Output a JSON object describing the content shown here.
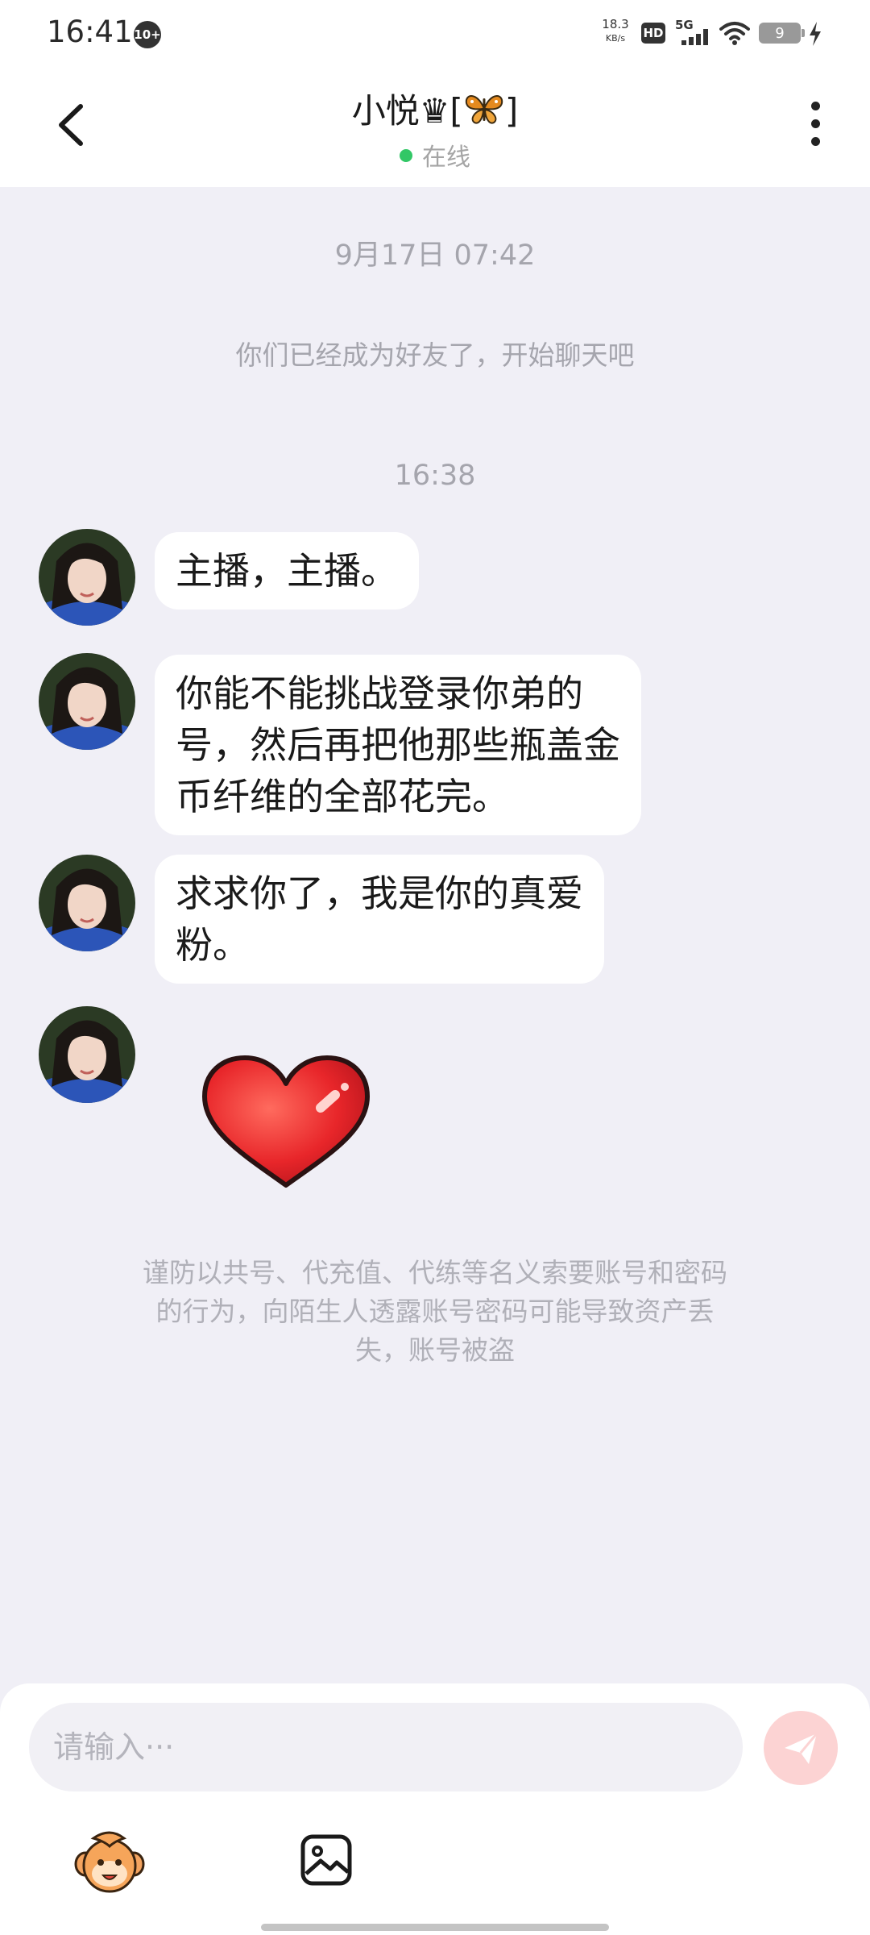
{
  "status_bar": {
    "time": "16:41",
    "notification_count": "10+",
    "net_speed": "18.3",
    "net_speed_unit": "KB/s",
    "hd_label": "HD",
    "network_label": "5G",
    "battery_level": "9"
  },
  "header": {
    "contact_name": "小悦♛[",
    "contact_name_suffix": "]",
    "status_text": "在线",
    "status_color": "#32c766"
  },
  "chat": {
    "timestamp_1": "9月17日 07:42",
    "system_message": "你们已经成为好友了，开始聊天吧",
    "timestamp_2": "16:38",
    "messages": [
      {
        "text": "主播，主播。"
      },
      {
        "line1": "你能不能挑战登录你弟的",
        "line2": "号，然后再把他那些瓶盖金",
        "line3": "币纤维的全部花完。"
      },
      {
        "line1": "求求你了，我是你的真爱",
        "line2": "粉。"
      },
      {
        "sticker": "red-heart"
      }
    ],
    "security_notice_line1": "谨防以共号、代充值、代练等名义索要账号和密码",
    "security_notice_line2": "的行为，向陌生人透露账号密码可能导致资产丢",
    "security_notice_line3": "失，账号被盗"
  },
  "composer": {
    "placeholder": "请输入···",
    "send_icon": "send-icon",
    "emoji_icon": "emoji-icon",
    "image_icon": "image-icon",
    "accent_color": "#fcd3d3"
  }
}
